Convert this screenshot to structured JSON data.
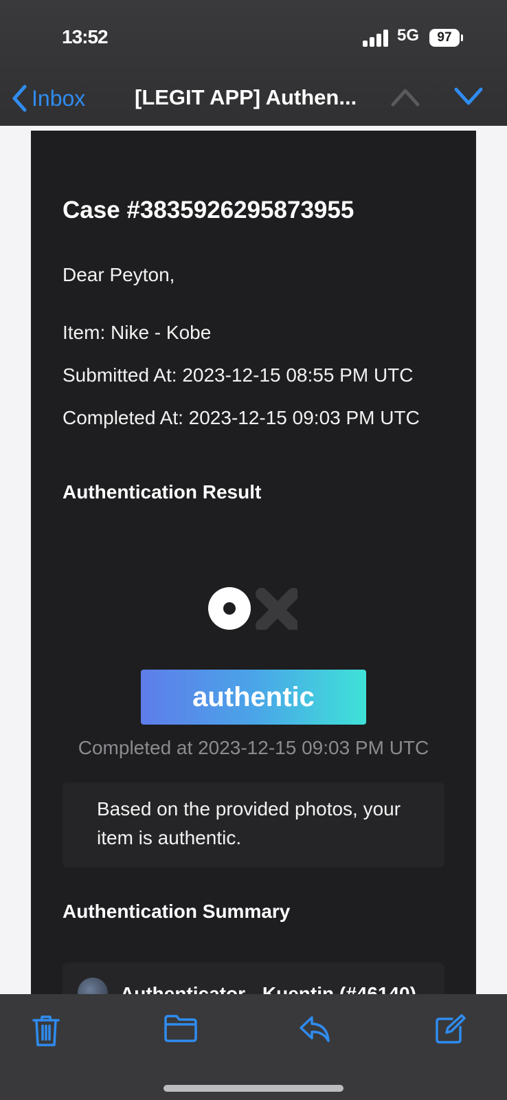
{
  "status_bar": {
    "time": "13:52",
    "battery": "97",
    "network": "5G"
  },
  "nav": {
    "back_label": "Inbox",
    "subject": "[LEGIT APP] Authen..."
  },
  "email": {
    "case_title": "Case #3835926295873955",
    "greeting": "Dear Peyton,",
    "item": "Item: Nike - Kobe",
    "submitted_at": "Submitted At: 2023-12-15 08:55 PM UTC",
    "completed_at": "Completed At: 2023-12-15 09:03 PM UTC",
    "result_heading": "Authentication Result",
    "badge_label": "authentic",
    "badge_completed": "Completed at 2023-12-15 09:03 PM UTC",
    "result_message": "Based on the provided photos, your item is authentic.",
    "summary_heading": "Authentication Summary",
    "authenticator": "Authenticator - Kuentin (#46140)"
  },
  "colors": {
    "accent": "#2f8cf0",
    "badge_gradient_start": "#5e7dea",
    "badge_gradient_end": "#3fe2d8",
    "email_bg": "#1e1e20"
  },
  "toolbar": {
    "icons": [
      "trash-icon",
      "folder-icon",
      "reply-icon",
      "compose-icon"
    ]
  }
}
